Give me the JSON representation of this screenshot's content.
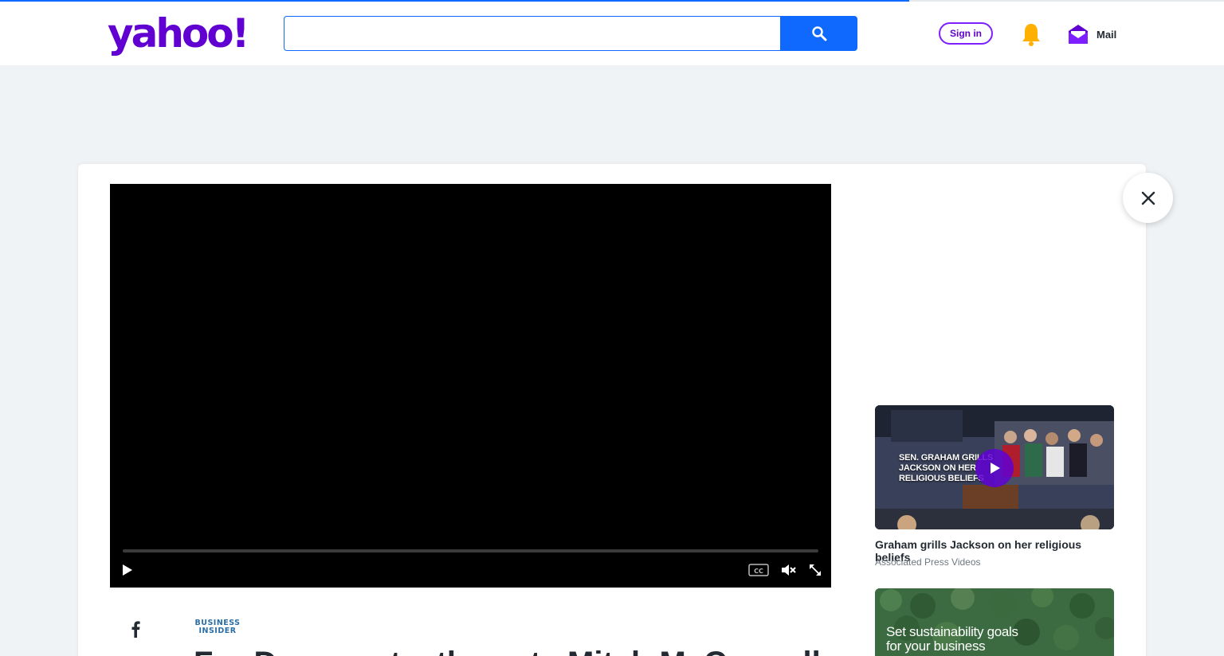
{
  "page_load": {
    "progress": 0.743
  },
  "header": {
    "logo_text": "yahoo!",
    "search": {
      "value": "",
      "placeholder": ""
    },
    "search_button_icon": "search-icon",
    "signin_label": "Sign in",
    "notification_icon": "bell-icon",
    "mail_icon": "mail-envelope-icon",
    "mail_label": "Mail"
  },
  "video_player": {
    "progress": 0,
    "controls": [
      "play-icon",
      "closed-captions-icon",
      "mute-icon",
      "fullscreen-icon"
    ]
  },
  "article": {
    "share_icon": "facebook-icon",
    "source_logo_line1": "BUSINESS",
    "source_logo_line2": "INSIDER",
    "headline": "For Democrats, the vote Mitch McConnell"
  },
  "related": [
    {
      "caption_line1": "SEN. GRAHAM GRILLS",
      "caption_line2": "JACKSON ON HER",
      "caption_line3": "RELIGIOUS BELIEFS",
      "title": "Graham grills Jackson on her religious beliefs",
      "source": "Associated Press Videos"
    },
    {
      "ad_line1": "Set sustainability goals",
      "ad_line2": "for your business"
    }
  ],
  "close_icon": "close-icon",
  "colors": {
    "brand": "#6001d2",
    "accent_blue": "#0f69ff",
    "background": "#f0f3f5",
    "text": "#232a31",
    "muted": "#6e7780"
  }
}
